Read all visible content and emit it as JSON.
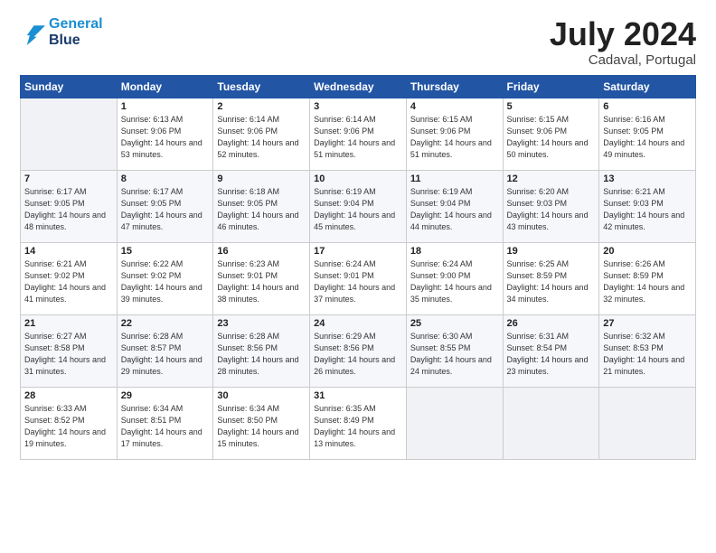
{
  "logo": {
    "line1": "General",
    "line2": "Blue"
  },
  "title": "July 2024",
  "subtitle": "Cadaval, Portugal",
  "days_of_week": [
    "Sunday",
    "Monday",
    "Tuesday",
    "Wednesday",
    "Thursday",
    "Friday",
    "Saturday"
  ],
  "weeks": [
    [
      {
        "day": "",
        "sunrise": "",
        "sunset": "",
        "daylight": ""
      },
      {
        "day": "1",
        "sunrise": "Sunrise: 6:13 AM",
        "sunset": "Sunset: 9:06 PM",
        "daylight": "Daylight: 14 hours and 53 minutes."
      },
      {
        "day": "2",
        "sunrise": "Sunrise: 6:14 AM",
        "sunset": "Sunset: 9:06 PM",
        "daylight": "Daylight: 14 hours and 52 minutes."
      },
      {
        "day": "3",
        "sunrise": "Sunrise: 6:14 AM",
        "sunset": "Sunset: 9:06 PM",
        "daylight": "Daylight: 14 hours and 51 minutes."
      },
      {
        "day": "4",
        "sunrise": "Sunrise: 6:15 AM",
        "sunset": "Sunset: 9:06 PM",
        "daylight": "Daylight: 14 hours and 51 minutes."
      },
      {
        "day": "5",
        "sunrise": "Sunrise: 6:15 AM",
        "sunset": "Sunset: 9:06 PM",
        "daylight": "Daylight: 14 hours and 50 minutes."
      },
      {
        "day": "6",
        "sunrise": "Sunrise: 6:16 AM",
        "sunset": "Sunset: 9:05 PM",
        "daylight": "Daylight: 14 hours and 49 minutes."
      }
    ],
    [
      {
        "day": "7",
        "sunrise": "Sunrise: 6:17 AM",
        "sunset": "Sunset: 9:05 PM",
        "daylight": "Daylight: 14 hours and 48 minutes."
      },
      {
        "day": "8",
        "sunrise": "Sunrise: 6:17 AM",
        "sunset": "Sunset: 9:05 PM",
        "daylight": "Daylight: 14 hours and 47 minutes."
      },
      {
        "day": "9",
        "sunrise": "Sunrise: 6:18 AM",
        "sunset": "Sunset: 9:05 PM",
        "daylight": "Daylight: 14 hours and 46 minutes."
      },
      {
        "day": "10",
        "sunrise": "Sunrise: 6:19 AM",
        "sunset": "Sunset: 9:04 PM",
        "daylight": "Daylight: 14 hours and 45 minutes."
      },
      {
        "day": "11",
        "sunrise": "Sunrise: 6:19 AM",
        "sunset": "Sunset: 9:04 PM",
        "daylight": "Daylight: 14 hours and 44 minutes."
      },
      {
        "day": "12",
        "sunrise": "Sunrise: 6:20 AM",
        "sunset": "Sunset: 9:03 PM",
        "daylight": "Daylight: 14 hours and 43 minutes."
      },
      {
        "day": "13",
        "sunrise": "Sunrise: 6:21 AM",
        "sunset": "Sunset: 9:03 PM",
        "daylight": "Daylight: 14 hours and 42 minutes."
      }
    ],
    [
      {
        "day": "14",
        "sunrise": "Sunrise: 6:21 AM",
        "sunset": "Sunset: 9:02 PM",
        "daylight": "Daylight: 14 hours and 41 minutes."
      },
      {
        "day": "15",
        "sunrise": "Sunrise: 6:22 AM",
        "sunset": "Sunset: 9:02 PM",
        "daylight": "Daylight: 14 hours and 39 minutes."
      },
      {
        "day": "16",
        "sunrise": "Sunrise: 6:23 AM",
        "sunset": "Sunset: 9:01 PM",
        "daylight": "Daylight: 14 hours and 38 minutes."
      },
      {
        "day": "17",
        "sunrise": "Sunrise: 6:24 AM",
        "sunset": "Sunset: 9:01 PM",
        "daylight": "Daylight: 14 hours and 37 minutes."
      },
      {
        "day": "18",
        "sunrise": "Sunrise: 6:24 AM",
        "sunset": "Sunset: 9:00 PM",
        "daylight": "Daylight: 14 hours and 35 minutes."
      },
      {
        "day": "19",
        "sunrise": "Sunrise: 6:25 AM",
        "sunset": "Sunset: 8:59 PM",
        "daylight": "Daylight: 14 hours and 34 minutes."
      },
      {
        "day": "20",
        "sunrise": "Sunrise: 6:26 AM",
        "sunset": "Sunset: 8:59 PM",
        "daylight": "Daylight: 14 hours and 32 minutes."
      }
    ],
    [
      {
        "day": "21",
        "sunrise": "Sunrise: 6:27 AM",
        "sunset": "Sunset: 8:58 PM",
        "daylight": "Daylight: 14 hours and 31 minutes."
      },
      {
        "day": "22",
        "sunrise": "Sunrise: 6:28 AM",
        "sunset": "Sunset: 8:57 PM",
        "daylight": "Daylight: 14 hours and 29 minutes."
      },
      {
        "day": "23",
        "sunrise": "Sunrise: 6:28 AM",
        "sunset": "Sunset: 8:56 PM",
        "daylight": "Daylight: 14 hours and 28 minutes."
      },
      {
        "day": "24",
        "sunrise": "Sunrise: 6:29 AM",
        "sunset": "Sunset: 8:56 PM",
        "daylight": "Daylight: 14 hours and 26 minutes."
      },
      {
        "day": "25",
        "sunrise": "Sunrise: 6:30 AM",
        "sunset": "Sunset: 8:55 PM",
        "daylight": "Daylight: 14 hours and 24 minutes."
      },
      {
        "day": "26",
        "sunrise": "Sunrise: 6:31 AM",
        "sunset": "Sunset: 8:54 PM",
        "daylight": "Daylight: 14 hours and 23 minutes."
      },
      {
        "day": "27",
        "sunrise": "Sunrise: 6:32 AM",
        "sunset": "Sunset: 8:53 PM",
        "daylight": "Daylight: 14 hours and 21 minutes."
      }
    ],
    [
      {
        "day": "28",
        "sunrise": "Sunrise: 6:33 AM",
        "sunset": "Sunset: 8:52 PM",
        "daylight": "Daylight: 14 hours and 19 minutes."
      },
      {
        "day": "29",
        "sunrise": "Sunrise: 6:34 AM",
        "sunset": "Sunset: 8:51 PM",
        "daylight": "Daylight: 14 hours and 17 minutes."
      },
      {
        "day": "30",
        "sunrise": "Sunrise: 6:34 AM",
        "sunset": "Sunset: 8:50 PM",
        "daylight": "Daylight: 14 hours and 15 minutes."
      },
      {
        "day": "31",
        "sunrise": "Sunrise: 6:35 AM",
        "sunset": "Sunset: 8:49 PM",
        "daylight": "Daylight: 14 hours and 13 minutes."
      },
      {
        "day": "",
        "sunrise": "",
        "sunset": "",
        "daylight": ""
      },
      {
        "day": "",
        "sunrise": "",
        "sunset": "",
        "daylight": ""
      },
      {
        "day": "",
        "sunrise": "",
        "sunset": "",
        "daylight": ""
      }
    ]
  ]
}
